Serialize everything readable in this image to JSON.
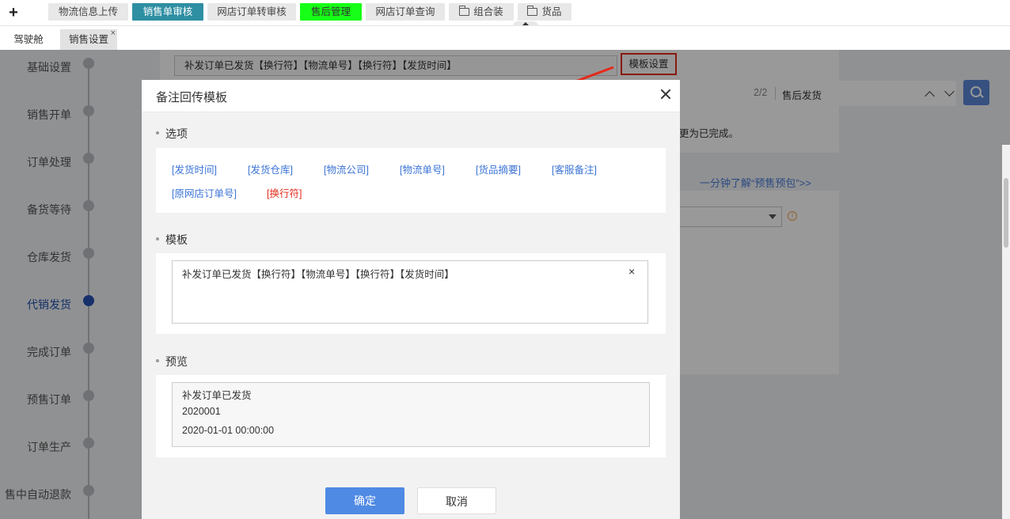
{
  "topbar": {
    "add_label": "+",
    "tabs": [
      {
        "label": "物流信息上传"
      },
      {
        "label": "销售单审核"
      },
      {
        "label": "网店订单转审核"
      },
      {
        "label": "售后管理"
      },
      {
        "label": "网店订单查询"
      },
      {
        "label": "组合装",
        "icon": "folder-icon"
      },
      {
        "label": "货品",
        "icon": "folder-icon"
      }
    ],
    "active_tab": "销售单审核",
    "highlight_color": "#16ff16"
  },
  "subbar": {
    "tabs": [
      {
        "label": "驾驶舱"
      },
      {
        "label": "销售设置",
        "close": "×"
      }
    ],
    "active_tab": "销售设置"
  },
  "sidebar": {
    "steps": [
      {
        "label": "基础设置"
      },
      {
        "label": "销售开单"
      },
      {
        "label": "订单处理"
      },
      {
        "label": "备货等待"
      },
      {
        "label": "仓库发货"
      },
      {
        "label": "代销发货"
      },
      {
        "label": "完成订单"
      },
      {
        "label": "预售订单"
      },
      {
        "label": "订单生产"
      },
      {
        "label": "售中自动退款"
      }
    ],
    "current": "代销发货"
  },
  "background": {
    "template_value": "补发订单已发货【换行符】【物流单号】【换行符】【发货时间】",
    "template_button": "模板设置",
    "pager": "2/2",
    "search_result": "售后发货",
    "note_tail": "更为已完成。",
    "presale_link": "一分钟了解“预售预包”>>",
    "warn_glyph": "!"
  },
  "modal": {
    "title": "备注回传模板",
    "options_heading": "选项",
    "options": [
      {
        "label": "[发货时间]"
      },
      {
        "label": "[发货仓库]"
      },
      {
        "label": "[物流公司]"
      },
      {
        "label": "[物流单号]"
      },
      {
        "label": "[货品摘要]"
      },
      {
        "label": "[客服备注]"
      },
      {
        "label": "[原网店订单号]"
      },
      {
        "label": "[换行符]",
        "color": "#e52a1c"
      }
    ],
    "template_heading": "模板",
    "template_value": "补发订单已发货【换行符】【物流单号】【换行符】【发货时间】",
    "clear_glyph": "×",
    "preview_heading": "预览",
    "preview_lines": [
      "补发订单已发货",
      "2020001",
      "2020-01-01 00:00:00"
    ],
    "ok_label": "确定",
    "cancel_label": "取消"
  },
  "annotation_color": "#e52a1c"
}
